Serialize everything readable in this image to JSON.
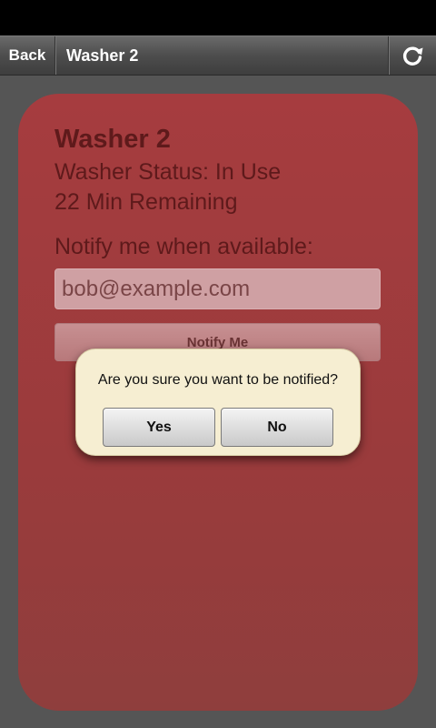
{
  "toolbar": {
    "back_label": "Back",
    "title": "Washer 2",
    "refresh_icon": "refresh-icon"
  },
  "card": {
    "title": "Washer 2",
    "status": "Washer Status: In Use",
    "remaining": "22 Min Remaining",
    "notify_label": "Notify me when available:",
    "email_value": "bob@example.com",
    "notify_button_label": "Notify Me"
  },
  "dialog": {
    "message": "Are you sure you want to be notified?",
    "yes_label": "Yes",
    "no_label": "No"
  },
  "colors": {
    "card_background": "#a63c3f",
    "page_background": "#555555",
    "dialog_background": "#f6eed2",
    "text_dark_red": "#5e1a1b"
  }
}
